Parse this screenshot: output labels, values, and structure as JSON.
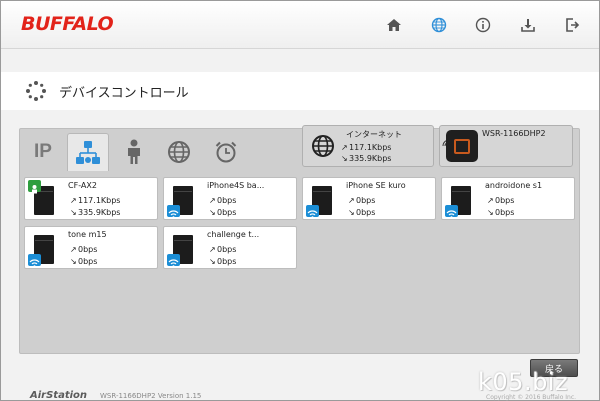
{
  "header": {
    "logo": "BUFFALO",
    "icons": [
      "home-icon",
      "globe-icon",
      "info-icon",
      "download-icon",
      "logout-icon"
    ]
  },
  "page": {
    "title": "デバイスコントロール"
  },
  "tabs": {
    "ip_label": "IP",
    "items": [
      "ip",
      "network-devices",
      "person",
      "internet",
      "alarm"
    ]
  },
  "internet_box": {
    "title": "インターネット",
    "up": "117.1Kbps",
    "down": "335.9Kbps"
  },
  "router_box": {
    "name": "WSR-1166DHP2"
  },
  "devices": [
    {
      "name": "CF-AX2",
      "up": "117.1Kbps",
      "down": "335.9Kbps",
      "conn": "wired"
    },
    {
      "name": "iPhone4S ba...",
      "up": "0bps",
      "down": "0bps",
      "conn": "wifi"
    },
    {
      "name": "iPhone SE kuro",
      "up": "0bps",
      "down": "0bps",
      "conn": "wifi"
    },
    {
      "name": "androidone s1",
      "up": "0bps",
      "down": "0bps",
      "conn": "wifi"
    },
    {
      "name": "tone m15",
      "up": "0bps",
      "down": "0bps",
      "conn": "wifi"
    },
    {
      "name": "challenge t...",
      "up": "0bps",
      "down": "0bps",
      "conn": "wifi"
    }
  ],
  "buttons": {
    "back": "戻る"
  },
  "footer": {
    "brand": "AirStation",
    "model": "WSR-1166DHP2 Version 1.15",
    "watermark": "k05.biz",
    "copyright": "Copyright © 2016 Buffalo Inc."
  },
  "colors": {
    "brand_red": "#e2231a",
    "wifi_blue": "#1b8ed6",
    "wired_green": "#2e9e3e"
  }
}
